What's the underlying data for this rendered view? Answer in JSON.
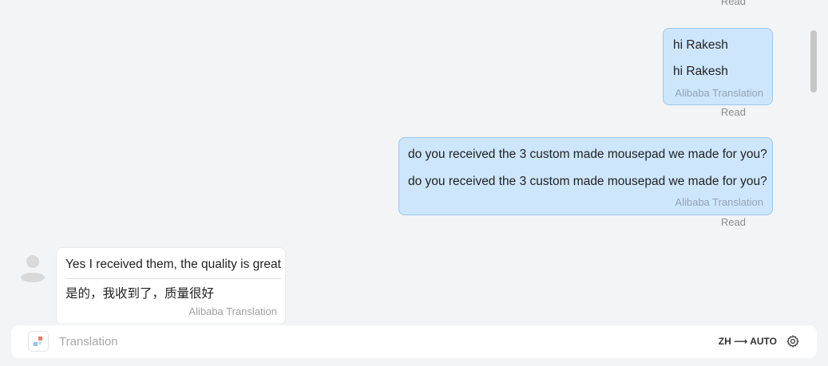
{
  "messages": [
    {
      "direction": "outgoing",
      "original": "hi Rakesh",
      "translated": "hi Rakesh",
      "translation_source": "Alibaba Translation",
      "status": "Read"
    },
    {
      "direction": "outgoing",
      "original": "do you received the 3 custom made mousepad we made for you?",
      "translated": "do you received the 3 custom made mousepad we made for you?",
      "translation_source": "Alibaba Translation",
      "status": "Read"
    },
    {
      "direction": "incoming",
      "original": "Yes I received them, the quality is great",
      "translated": "是的，我收到了，质量很好",
      "translation_source": "Alibaba Translation"
    }
  ],
  "top_status": "Read",
  "input_bar": {
    "placeholder": "Translation",
    "language_pair": "ZH ⟶ AUTO"
  },
  "icons": {
    "avatar": "user-avatar-icon",
    "logo": "translation-logo-icon",
    "settings": "gear-icon"
  }
}
